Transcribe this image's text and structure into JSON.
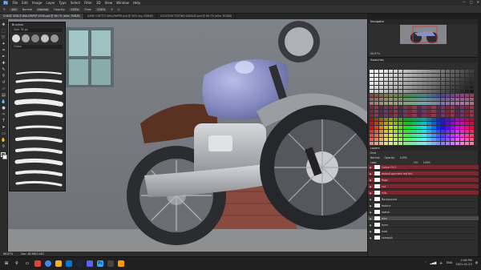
{
  "menu": [
    "File",
    "Edit",
    "Image",
    "Layer",
    "Type",
    "Select",
    "Filter",
    "3D",
    "View",
    "Window",
    "Help"
  ],
  "options": {
    "size": "100",
    "mode_label": "Normal",
    "mode": "Normal",
    "opacity_label": "Opacity:",
    "opacity": "100%",
    "flow_label": "Flow:",
    "flow": "100%"
  },
  "tabs": [
    "CHASE GRACE WALLPAPER 4556.psd @ 66.7% (bike, RGB/8)",
    "GAME GHETTO WALLPAPER.psd @ 50% (bg, RGB/8)",
    "LOCATION TESTING GARAGE.psd @ 66.7% (bike, RGB/8)"
  ],
  "brushes_panel": {
    "title": "Brushes",
    "size_label": "Size:",
    "size_value": "30 px",
    "group_label": "Chase"
  },
  "status": {
    "zoom": "66.67%",
    "doc": "Doc: 48.9M/2.04G"
  },
  "navigator": {
    "title": "Navigator",
    "zoom": "66.67%"
  },
  "swatches": {
    "title": "Swatches"
  },
  "layers": {
    "title": "Layers",
    "kind_label": "Kind",
    "blend": "Normal",
    "opacity_label": "Opacity:",
    "opacity": "100%",
    "lock_label": "Lock:",
    "fill_label": "Fill:",
    "fill": "100%",
    "rows": [
      "Colour Fill 1",
      "default garment red tint",
      "flags",
      "cat",
      "hills",
      "Background",
      "texture",
      "sketch",
      "bike",
      "tyres",
      "road",
      "sidewalk"
    ]
  },
  "taskbar": {
    "time": "2:56 PM",
    "date": "2021-01-23",
    "lang": "ENG"
  },
  "colors": {
    "accent_red": "#7b2730",
    "ui_dark": "#2e2e2e"
  }
}
